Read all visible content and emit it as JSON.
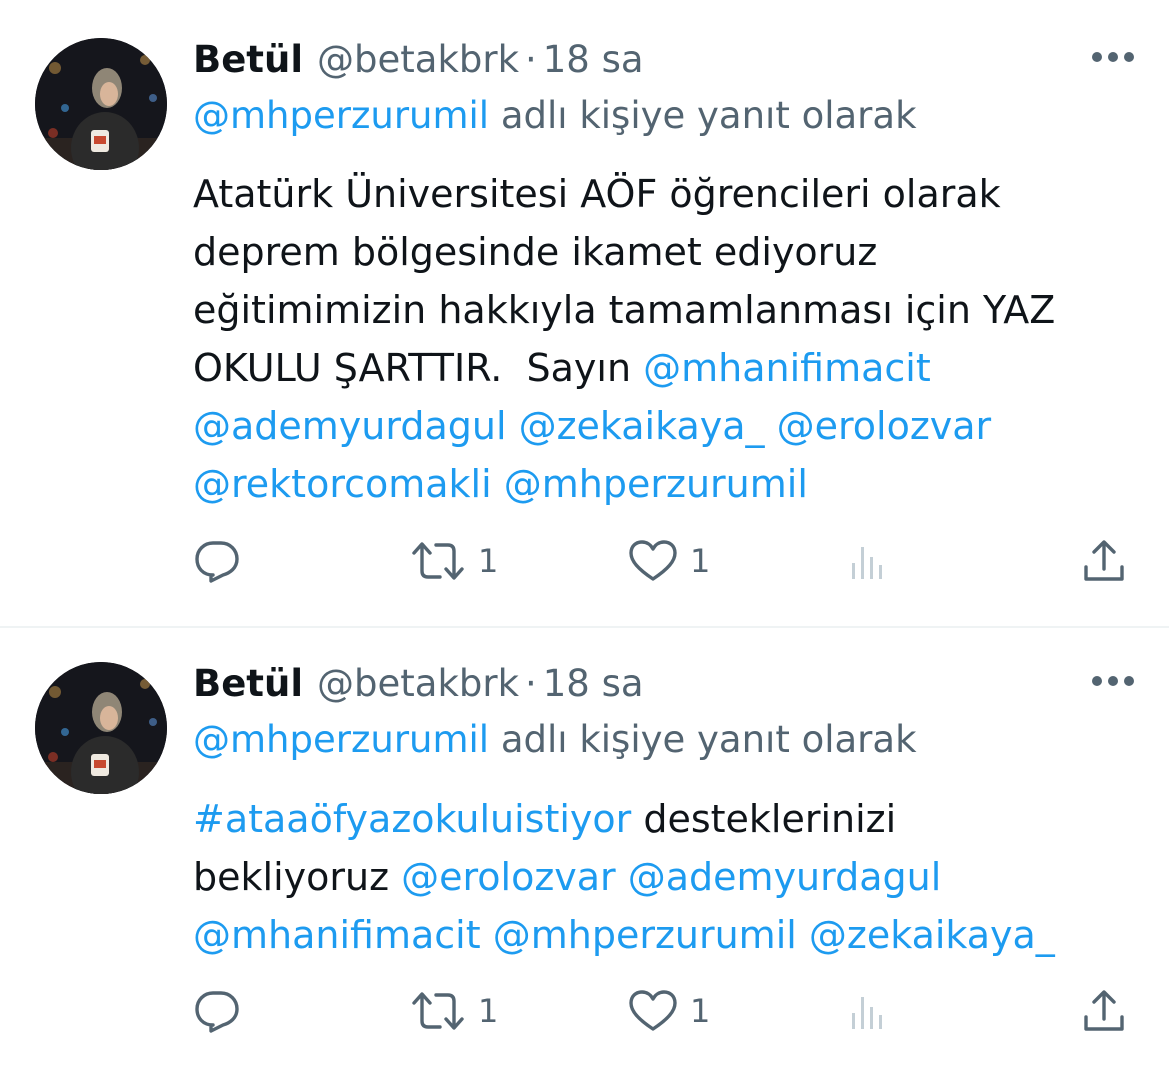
{
  "tweets": [
    {
      "author": {
        "name": "Betül",
        "handle": "@betakbrk",
        "time": "18 sa"
      },
      "replying_to": {
        "handle": "@mhperzurumil",
        "suffix": "adlı kişiye yanıt olarak"
      },
      "body": {
        "line1": "Atatürk Üniversitesi AÖF öğrencileri olarak",
        "line2": "deprem bölgesinde ikamet ediyoruz",
        "line3": "eğitimimizin hakkıyla tamamlanması için YAZ",
        "line4_text": "OKULU ŞARTTIR.  Sayın ",
        "line4_mention": "@mhanifimacit",
        "line5_mentions": [
          "@ademyurdagul",
          "@zekaikaya_",
          "@erolozvar"
        ],
        "line6_mentions": [
          "@rektorcomakli",
          "@mhperzurumil"
        ]
      },
      "actions": {
        "replies": "",
        "retweets": "1",
        "likes": "1",
        "views": ""
      }
    },
    {
      "author": {
        "name": "Betül",
        "handle": "@betakbrk",
        "time": "18 sa"
      },
      "replying_to": {
        "handle": "@mhperzurumil",
        "suffix": "adlı kişiye yanıt olarak"
      },
      "body": {
        "line1_hashtag": "#ataaöfyazokuluistiyor",
        "line1_text": " desteklerinizi",
        "line2_text": "bekliyoruz ",
        "line2_mentions": [
          "@erolozvar",
          "@ademyurdagul"
        ],
        "line3_mentions": [
          "@mhanifimacit",
          "@mhperzurumil",
          "@zekaikaya_"
        ]
      },
      "actions": {
        "replies": "",
        "retweets": "1",
        "likes": "1",
        "views": ""
      }
    }
  ],
  "icons": {
    "more": "more-horizontal-icon",
    "reply": "reply-icon",
    "retweet": "retweet-icon",
    "like": "heart-icon",
    "views": "analytics-icon",
    "share": "share-icon"
  },
  "colors": {
    "link": "#1d9bf0",
    "secondary_text": "#536471",
    "primary_text": "#0f1419",
    "divider": "#eff3f4"
  }
}
